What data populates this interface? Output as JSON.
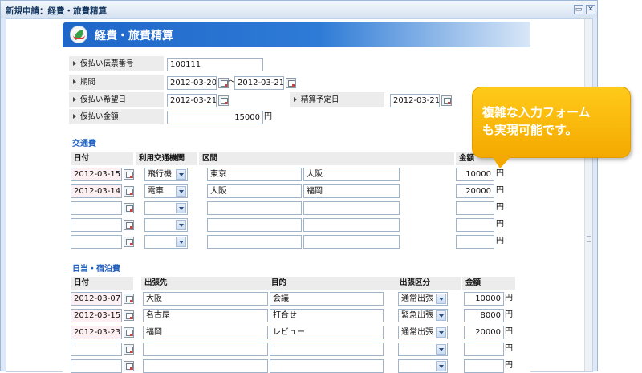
{
  "window": {
    "title": "新規申請：経費・旅費精算",
    "restore_icon": "restore-icon",
    "close_icon": "close-icon"
  },
  "form": {
    "title": "経費・旅費精算",
    "fields": {
      "voucher_no": {
        "label": "仮払い伝票番号",
        "value": "100111"
      },
      "period": {
        "label": "期間",
        "from": "2012-03-20",
        "sep": "～",
        "to": "2012-03-21"
      },
      "request_date": {
        "label": "仮払い希望日",
        "value": "2012-03-21"
      },
      "settle_date": {
        "label": "精算予定日",
        "value": "2012-03-21"
      },
      "amount": {
        "label": "仮払い金額",
        "value": "15000",
        "unit": "円"
      }
    },
    "transport": {
      "heading": "交通費",
      "columns": {
        "date": "日付",
        "means": "利用交通機関",
        "section": "区間",
        "amount": "金額"
      },
      "unit": "円",
      "rows": [
        {
          "date": "2012-03-15",
          "means": "飛行機",
          "from": "東京",
          "to": "大阪",
          "amount": "10000"
        },
        {
          "date": "2012-03-14",
          "means": "電車",
          "from": "大阪",
          "to": "福岡",
          "amount": "20000"
        },
        {
          "date": "",
          "means": "",
          "from": "",
          "to": "",
          "amount": ""
        },
        {
          "date": "",
          "means": "",
          "from": "",
          "to": "",
          "amount": ""
        },
        {
          "date": "",
          "means": "",
          "from": "",
          "to": "",
          "amount": ""
        }
      ]
    },
    "allowance": {
      "heading": "日当・宿泊費",
      "columns": {
        "date": "日付",
        "destination": "出張先",
        "purpose": "目的",
        "trip_type": "出張区分",
        "amount": "金額"
      },
      "unit": "円",
      "rows": [
        {
          "date": "2012-03-07",
          "destination": "大阪",
          "purpose": "会議",
          "trip_type": "通常出張",
          "amount": "10000"
        },
        {
          "date": "2012-03-15",
          "destination": "名古屋",
          "purpose": "打合せ",
          "trip_type": "緊急出張",
          "amount": "8000"
        },
        {
          "date": "2012-03-23",
          "destination": "福岡",
          "purpose": "レビュー",
          "trip_type": "通常出張",
          "amount": "20000"
        },
        {
          "date": "",
          "destination": "",
          "purpose": "",
          "trip_type": "",
          "amount": ""
        },
        {
          "date": "",
          "destination": "",
          "purpose": "",
          "trip_type": "",
          "amount": ""
        }
      ]
    }
  },
  "callout": {
    "text": "複雑な入力フォーム\nも実現可能です。"
  }
}
